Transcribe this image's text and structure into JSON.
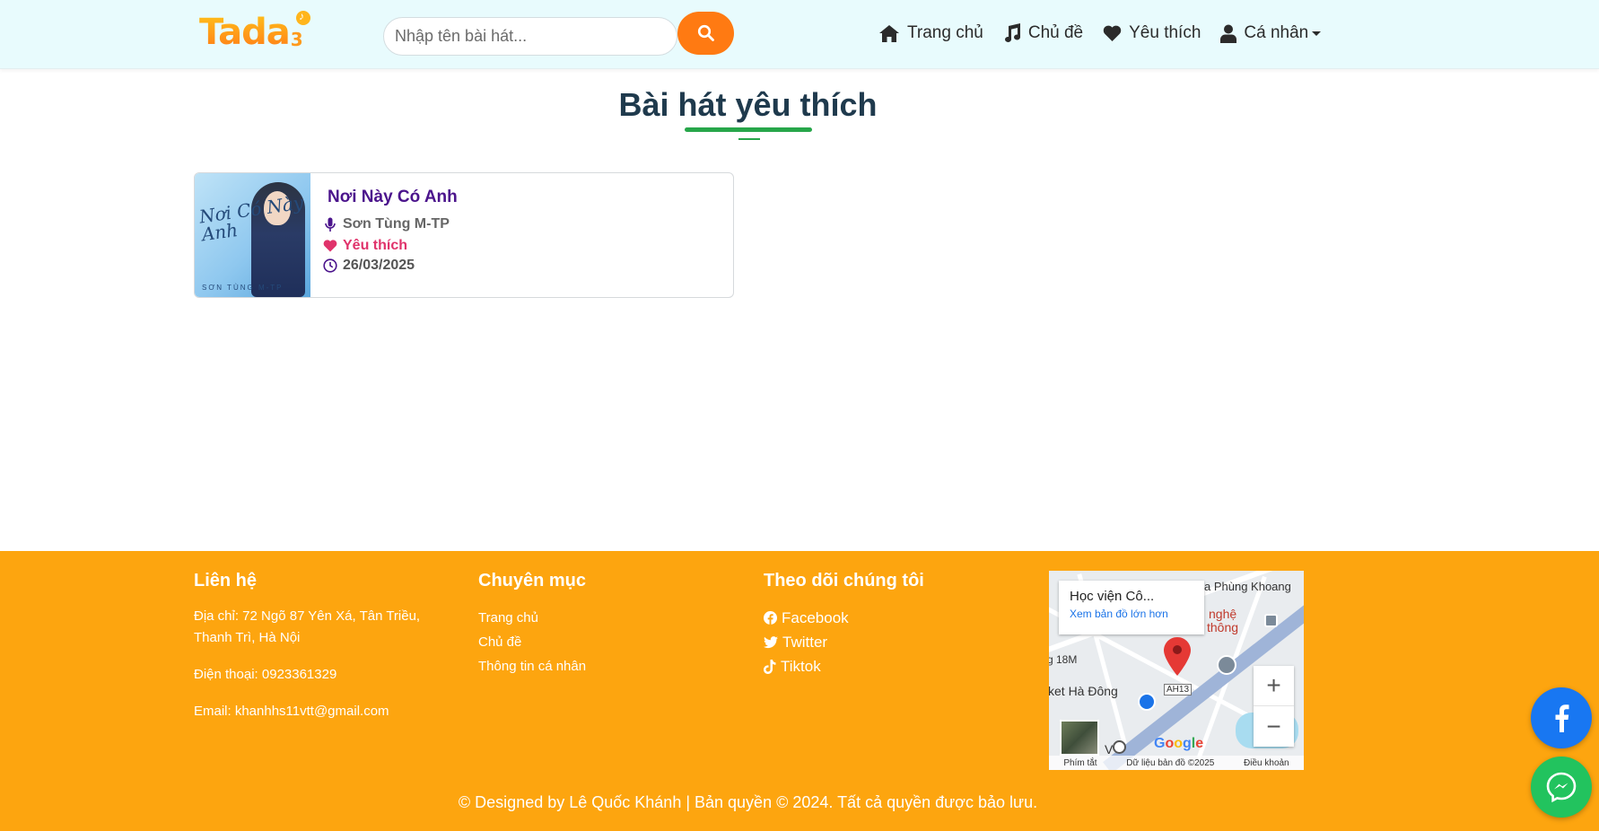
{
  "header": {
    "logo_text": "Tada",
    "logo_suffix": "3",
    "search": {
      "placeholder": "Nhập tên bài hát...",
      "value": ""
    },
    "nav": [
      {
        "label": "Trang chủ",
        "icon": "home-icon"
      },
      {
        "label": "Chủ đề",
        "icon": "music-note-icon"
      },
      {
        "label": "Yêu thích",
        "icon": "heart-icon"
      },
      {
        "label": "Cá nhân",
        "icon": "user-icon",
        "dropdown": true
      }
    ]
  },
  "main": {
    "title": "Bài hát yêu thích",
    "songs": [
      {
        "title": "Nơi Này Có Anh",
        "artist": "Sơn Tùng M-TP",
        "favorite_label": "Yêu thích",
        "date": "26/03/2025",
        "cover_title": "Nơi Có Này Anh",
        "cover_footer": "SƠN TÙNG M-TP"
      }
    ]
  },
  "footer": {
    "contact": {
      "heading": "Liên hệ",
      "address": "Địa chỉ: 72 Ngõ 87 Yên Xá, Tân Triều, Thanh Trì, Hà Nội",
      "phone": "Điện thoại: 0923361329",
      "email": "Email: khanhhs11vtt@gmail.com"
    },
    "categories": {
      "heading": "Chuyên mục",
      "links": [
        "Trang chủ",
        "Chủ đề",
        "Thông tin cá nhân"
      ]
    },
    "social": {
      "heading": "Theo dõi chúng tôi",
      "links": [
        {
          "label": "Facebook",
          "icon": "facebook-icon"
        },
        {
          "label": "Twitter",
          "icon": "twitter-icon"
        },
        {
          "label": "Tiktok",
          "icon": "tiktok-icon"
        }
      ]
    },
    "map": {
      "place_title": "Học viện Cô...",
      "view_larger": "Xem bản đồ lớn hơn",
      "label_street": "a Phùng Khoang",
      "label_nghe": "nghệ",
      "label_thong": "thông",
      "label_18m": "g 18M",
      "label_market": "ket Hà Đông",
      "label_ah13": "AH13",
      "label_vn": "V",
      "shortcuts": "Phím tắt",
      "map_data": "Dữ liệu bản đồ ©2025",
      "terms": "Điều khoản",
      "google": "Google"
    },
    "copyright": "© Designed by Lê Quốc Khánh | Bản quyền © 2024. Tất cả quyền được bảo lưu."
  },
  "colors": {
    "header_bg": "#e8fbfd",
    "accent_orange": "#ff7a12",
    "footer_bg": "#fda50f",
    "title_underline": "#27a64a",
    "song_title": "#4b148c",
    "favorite": "#e0336b",
    "facebook": "#1877f2",
    "messenger": "#22c35e"
  }
}
